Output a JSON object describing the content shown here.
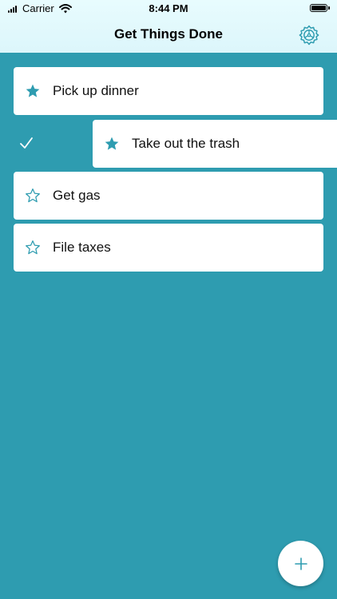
{
  "status_bar": {
    "carrier": "Carrier",
    "time": "8:44 PM"
  },
  "nav": {
    "title": "Get Things Done",
    "settings_icon": "gear-icon"
  },
  "colors": {
    "background": "#2e9cb0",
    "accent": "#2e9cb0",
    "header": "#e3fafd",
    "card": "#ffffff"
  },
  "tasks": [
    {
      "label": "Pick up dinner",
      "starred": true,
      "swiped": false
    },
    {
      "label": "Take out the trash",
      "starred": true,
      "swiped": true
    },
    {
      "label": "Get gas",
      "starred": false,
      "swiped": false
    },
    {
      "label": "File taxes",
      "starred": false,
      "swiped": false
    }
  ],
  "swipe_action": {
    "icon": "checkmark-icon"
  },
  "fab": {
    "icon": "plus-icon"
  }
}
